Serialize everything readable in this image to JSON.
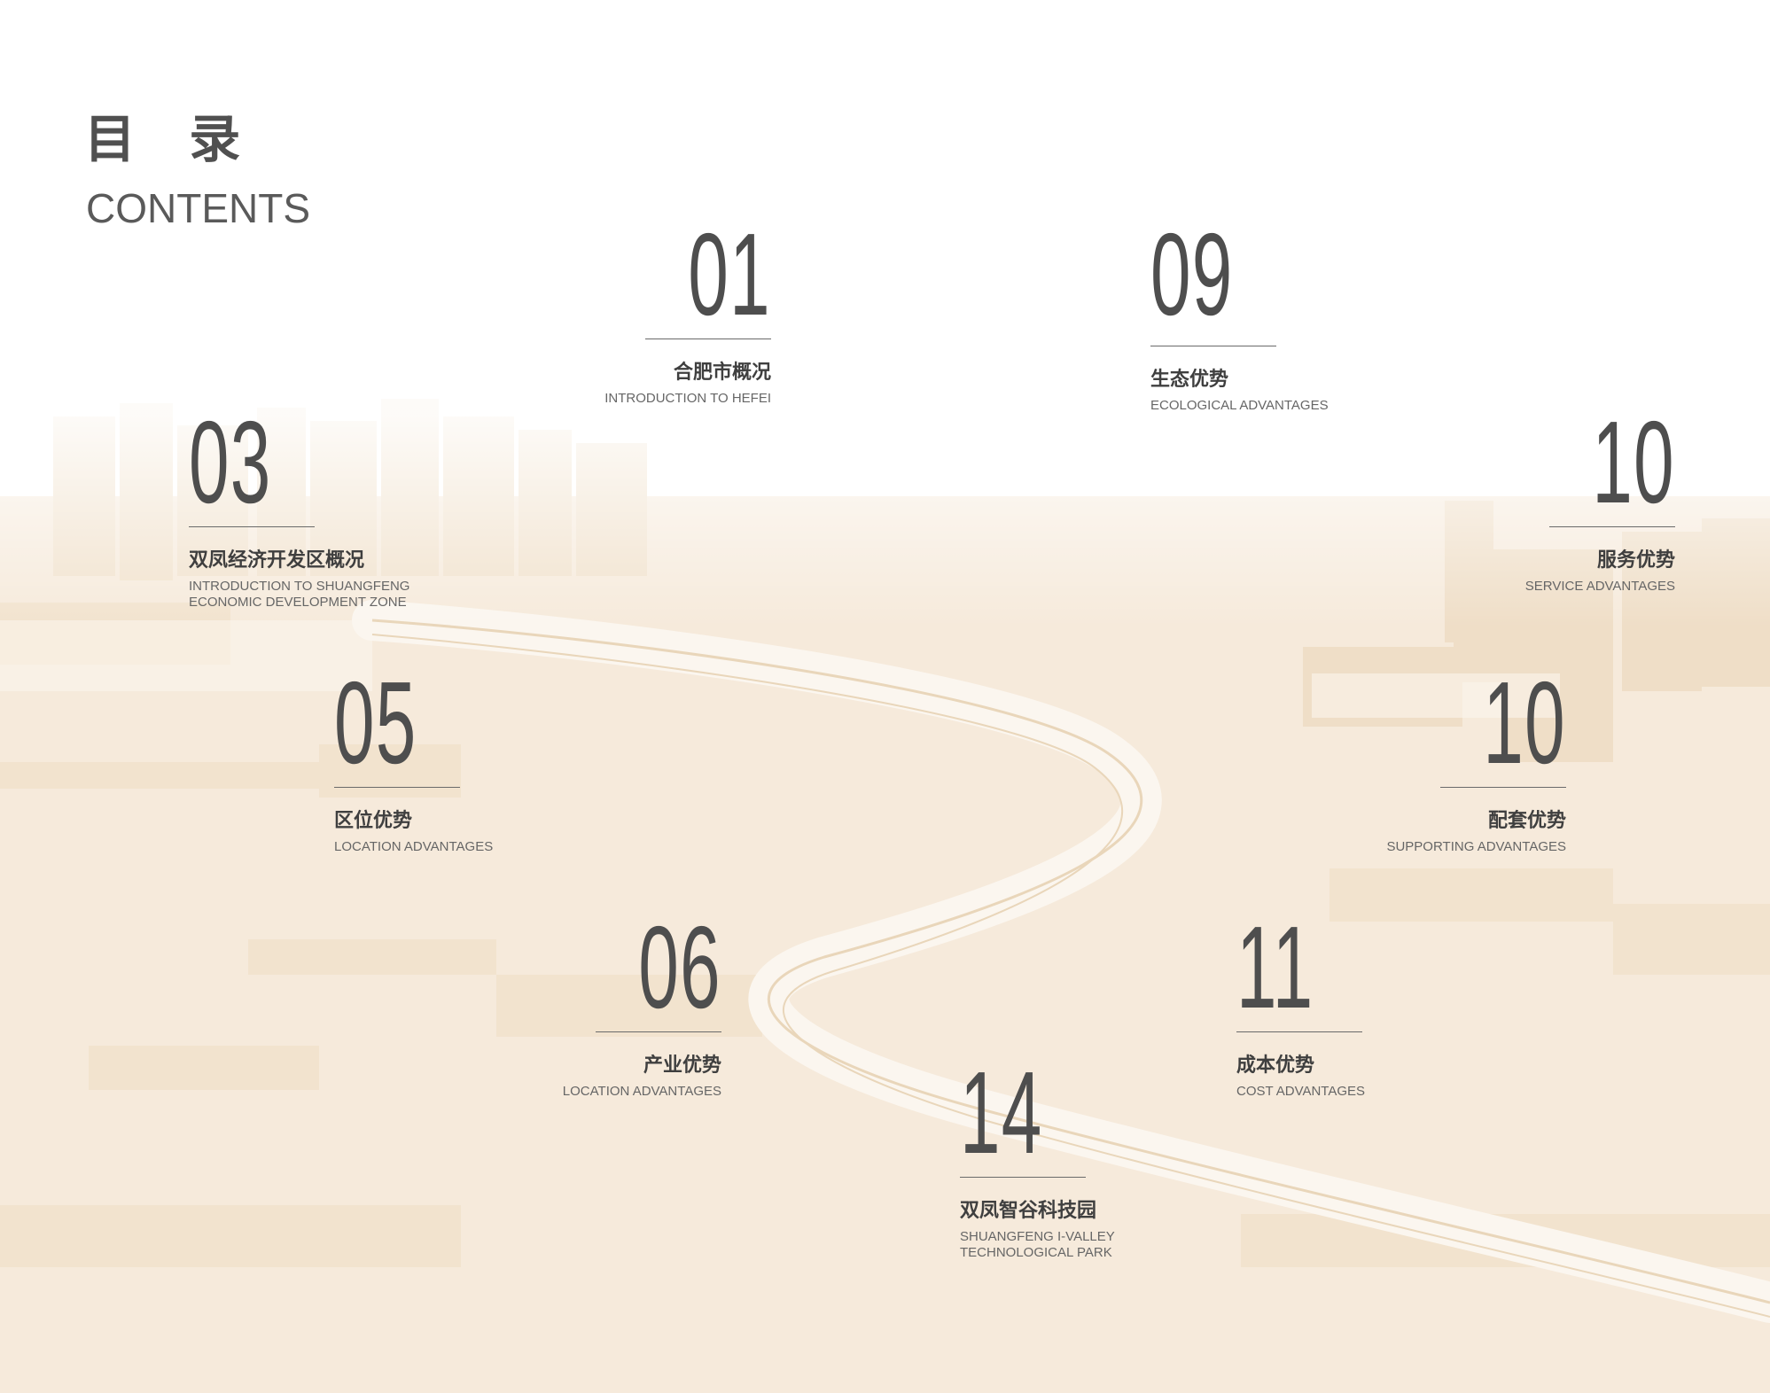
{
  "header": {
    "title_cn": "目 录",
    "title_en": "CONTENTS"
  },
  "entries": [
    {
      "number": "01",
      "title_cn": "合肥市概况",
      "title_en": "INTRODUCTION TO HEFEI"
    },
    {
      "number": "09",
      "title_cn": "生态优势",
      "title_en": "ECOLOGICAL ADVANTAGES"
    },
    {
      "number": "03",
      "title_cn": "双凤经济开发区概况",
      "title_en": "INTRODUCTION TO SHUANGFENG\nECONOMIC DEVELOPMENT ZONE"
    },
    {
      "number": "10",
      "title_cn": "服务优势",
      "title_en": "SERVICE ADVANTAGES"
    },
    {
      "number": "05",
      "title_cn": "区位优势",
      "title_en": "LOCATION ADVANTAGES"
    },
    {
      "number": "10",
      "title_cn": "配套优势",
      "title_en": "SUPPORTING ADVANTAGES"
    },
    {
      "number": "06",
      "title_cn": "产业优势",
      "title_en": "LOCATION ADVANTAGES"
    },
    {
      "number": "11",
      "title_cn": "成本优势",
      "title_en": "COST ADVANTAGES"
    },
    {
      "number": "14",
      "title_cn": "双凤智谷科技园",
      "title_en": "SHUANGFENG I-VALLEY\nTECHNOLOGICAL PARK"
    }
  ],
  "colors": {
    "background_tint": "#f5e8d6",
    "text_dark": "#4a4a4a"
  }
}
